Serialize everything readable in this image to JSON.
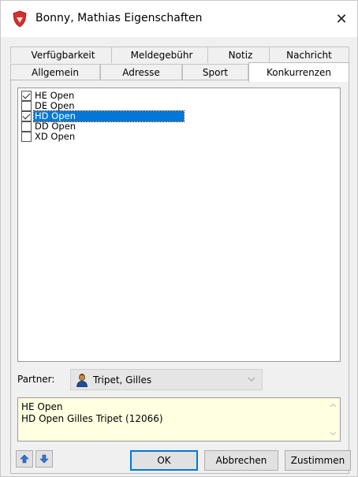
{
  "window": {
    "title": "Bonny, Mathias Eigenschaften",
    "close_glyph": "✕"
  },
  "tabs": {
    "row1": [
      "Verfügbarkeit",
      "Meldegebühr",
      "Notiz",
      "Nachricht"
    ],
    "row2": [
      "Allgemein",
      "Adresse",
      "Sport",
      "Konkurrenzen"
    ],
    "active": "Konkurrenzen"
  },
  "competitions": [
    {
      "label": "HE Open",
      "checked": true,
      "selected": false
    },
    {
      "label": "DE Open",
      "checked": false,
      "selected": false
    },
    {
      "label": "HD Open",
      "checked": true,
      "selected": true
    },
    {
      "label": "DD Open",
      "checked": false,
      "selected": false
    },
    {
      "label": "XD Open",
      "checked": false,
      "selected": false
    }
  ],
  "partner": {
    "label": "Partner:",
    "value": "Tripet, Gilles",
    "icon": "person-icon"
  },
  "info": {
    "lines": [
      "HE Open",
      "HD Open Gilles Tripet (12066)"
    ]
  },
  "buttons": {
    "up_icon": "arrow-up-icon",
    "down_icon": "arrow-down-icon",
    "ok": "OK",
    "cancel": "Abbrechen",
    "apply": "Zustimmen"
  },
  "colors": {
    "selection": "#0078d7",
    "info_background": "#ffffe1",
    "title_icon": "#d0312d"
  }
}
